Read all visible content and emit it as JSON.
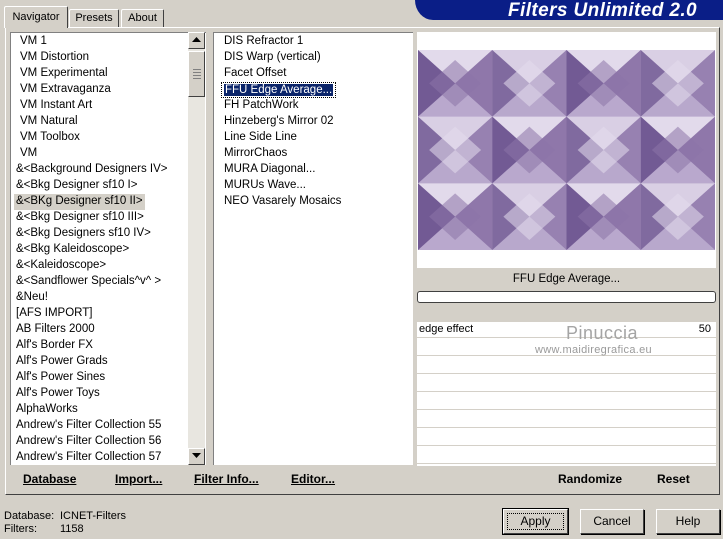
{
  "tabs": [
    "Navigator",
    "Presets",
    "About"
  ],
  "banner_title": "Filters Unlimited 2.0",
  "categories": [
    "VM 1",
    "VM Distortion",
    "VM Experimental",
    "VM Extravaganza",
    "VM Instant Art",
    "VM Natural",
    "VM Toolbox",
    "VM",
    "&<Background Designers IV>",
    "&<Bkg Designer sf10 I>",
    "&<BKg Designer sf10 II>",
    "&<Bkg Designer sf10 III>",
    "&<Bkg Designers sf10 IV>",
    "&<Bkg Kaleidoscope>",
    "&<Kaleidoscope>",
    "&<Sandflower Specials^v^ >",
    "&Neu!",
    "[AFS IMPORT]",
    "AB Filters 2000",
    "Alf's Border FX",
    "Alf's Power Grads",
    "Alf's Power Sines",
    "Alf's Power Toys",
    "AlphaWorks",
    "Andrew's Filter Collection 55",
    "Andrew's Filter Collection 56",
    "Andrew's Filter Collection 57"
  ],
  "selected_category": "&<BKg Designer sf10 II>",
  "filters": [
    "DIS Refractor 1",
    "DIS Warp (vertical)",
    "Facet Offset",
    "FFU Edge Average...",
    "FH PatchWork",
    "Hinzeberg's Mirror 02",
    "Line Side Line",
    "MirrorChaos",
    "MURA Diagonal...",
    "MURUs Wave...",
    "NEO Vasarely Mosaics"
  ],
  "selected_filter": "FFU Edge Average...",
  "preview": {
    "filter_name": "FFU Edge Average...",
    "progress": 0,
    "colors": {
      "light": "#e4dcec",
      "mid": "#b8a8cc",
      "dark": "#8c74a8",
      "deep": "#6e5590"
    }
  },
  "params": [
    {
      "label": "edge effect",
      "value": "50"
    }
  ],
  "watermark": {
    "name": "Pinuccia",
    "url": "www.maidiregrafica.eu"
  },
  "toolbar": {
    "database": "Database",
    "import": "Import...",
    "filter_info": "Filter Info...",
    "editor": "Editor...",
    "randomize": "Randomize",
    "reset": "Reset"
  },
  "status": {
    "database_label": "Database:",
    "database_value": "ICNET-Filters",
    "filters_label": "Filters:",
    "filters_value": "1158"
  },
  "buttons": {
    "apply": "Apply",
    "cancel": "Cancel",
    "help": "Help"
  }
}
